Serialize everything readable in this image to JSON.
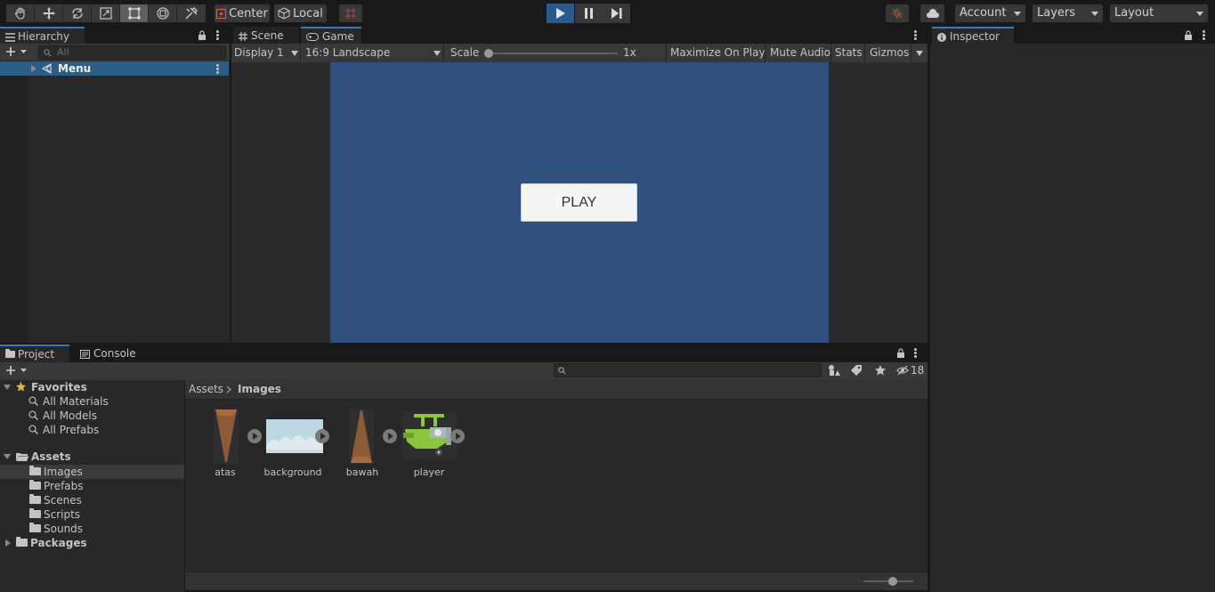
{
  "toolbar": {
    "tools": [
      "hand-tool-icon",
      "move-tool-icon",
      "rotate-tool-icon",
      "scale-tool-icon",
      "rect-tool-icon",
      "transform-tool-icon",
      "custom-tool-icon"
    ],
    "pivot_mode": "Center",
    "pivot_rotation": "Local",
    "account_label": "Account",
    "layers_label": "Layers",
    "layout_label": "Layout"
  },
  "hierarchy": {
    "tab_label": "Hierarchy",
    "search_placeholder": "All",
    "items": [
      {
        "label": "Menu"
      }
    ]
  },
  "game_view": {
    "tabs": [
      {
        "label": "Scene"
      },
      {
        "label": "Game"
      }
    ],
    "display_label": "Display 1",
    "aspect_label": "16:9 Landscape",
    "scale_label": "Scale",
    "scale_value_label": "1x",
    "maximize_label": "Maximize On Play",
    "mute_label": "Mute Audio",
    "stats_label": "Stats",
    "gizmos_label": "Gizmos",
    "play_button_label": "PLAY",
    "game_bg_color": "#30507e"
  },
  "inspector": {
    "tab_label": "Inspector"
  },
  "project": {
    "tabs": [
      {
        "label": "Project"
      },
      {
        "label": "Console"
      }
    ],
    "hidden_count": "18",
    "favorites_label": "Favorites",
    "favorites": [
      {
        "label": "All Materials"
      },
      {
        "label": "All Models"
      },
      {
        "label": "All Prefabs"
      }
    ],
    "assets_label": "Assets",
    "asset_folders": [
      {
        "label": "Images"
      },
      {
        "label": "Prefabs"
      },
      {
        "label": "Scenes"
      },
      {
        "label": "Scripts"
      },
      {
        "label": "Sounds"
      }
    ],
    "packages_label": "Packages",
    "breadcrumb": [
      "Assets",
      "Images"
    ],
    "files": [
      {
        "label": "atas"
      },
      {
        "label": "background"
      },
      {
        "label": "bawah"
      },
      {
        "label": "player"
      }
    ]
  }
}
